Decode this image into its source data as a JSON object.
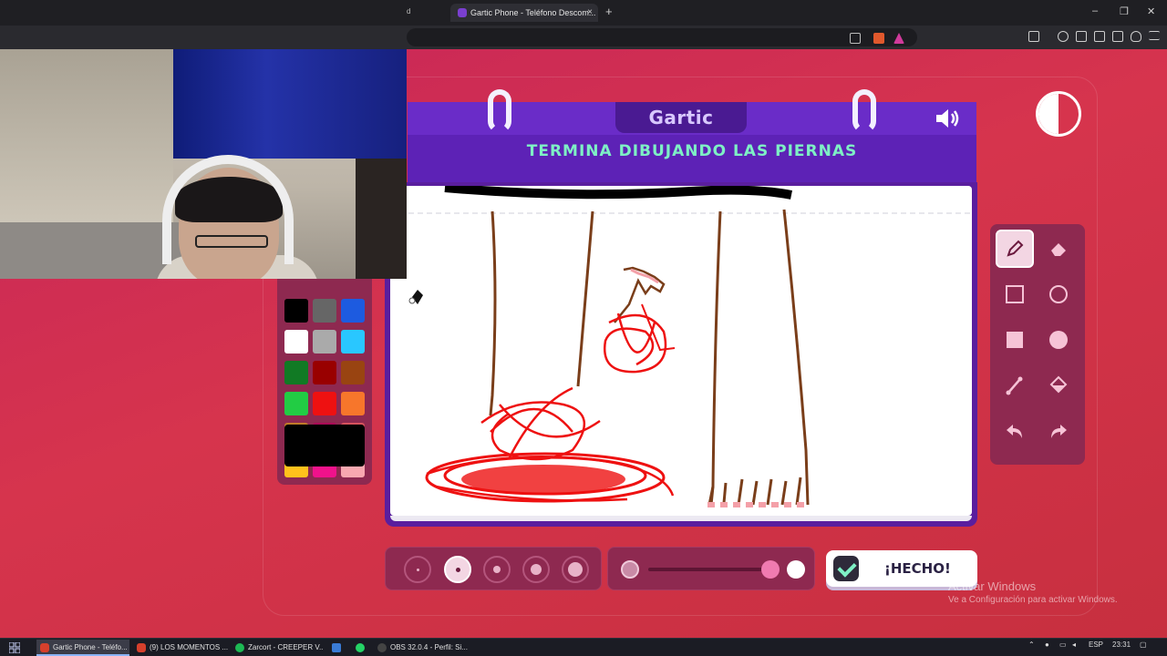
{
  "browser": {
    "tab_partial": "d",
    "active_tab_title": "Gartic Phone - Teléfono Descom...",
    "tab_close": "×",
    "new_tab": "+",
    "window_controls": [
      "–",
      "❐",
      "✕"
    ]
  },
  "game": {
    "logo": "Gartic",
    "instruction": "TERMINA DIBUJANDO LAS PIERNAS",
    "done_label": "¡HECHO!",
    "sound_icon": "speaker-icon",
    "selected_color": "#000000",
    "palette": [
      "#000000",
      "#666666",
      "#1d5be0",
      "#ffffff",
      "#aaaaaa",
      "#29c7ff",
      "#117a24",
      "#990000",
      "#994411",
      "#22cc44",
      "#ee1111",
      "#f7762b",
      "#c07a28",
      "#aa0a56",
      "#d6525c",
      "#ffc21c",
      "#f0128b",
      "#f8a8b0"
    ],
    "tools": [
      "pencil-icon",
      "eraser-icon",
      "rectangle-outline-icon",
      "circle-outline-icon",
      "rectangle-fill-icon",
      "circle-fill-icon",
      "line-icon",
      "fill-bucket-icon",
      "undo-icon",
      "redo-icon"
    ],
    "active_tool": "pencil-icon",
    "brush_sizes": 5,
    "active_brush_size": 2
  },
  "windows_notice": {
    "line1": "Activar Windows",
    "line2": "Ve a Configuración para activar Windows."
  },
  "taskbar": {
    "items": [
      {
        "label": "Gartic Phone - Teléfo...",
        "color": "#d6402c"
      },
      {
        "label": "(9) LOS MOMENTOS ...",
        "color": "#d6402c"
      },
      {
        "label": "Zarcort - CREEPER V...",
        "color": "#1db954"
      },
      {
        "label": "OBS 32.0.4 - Perfil: Si...",
        "color": "#444444"
      }
    ],
    "language": "ESP",
    "time": "23:31"
  }
}
